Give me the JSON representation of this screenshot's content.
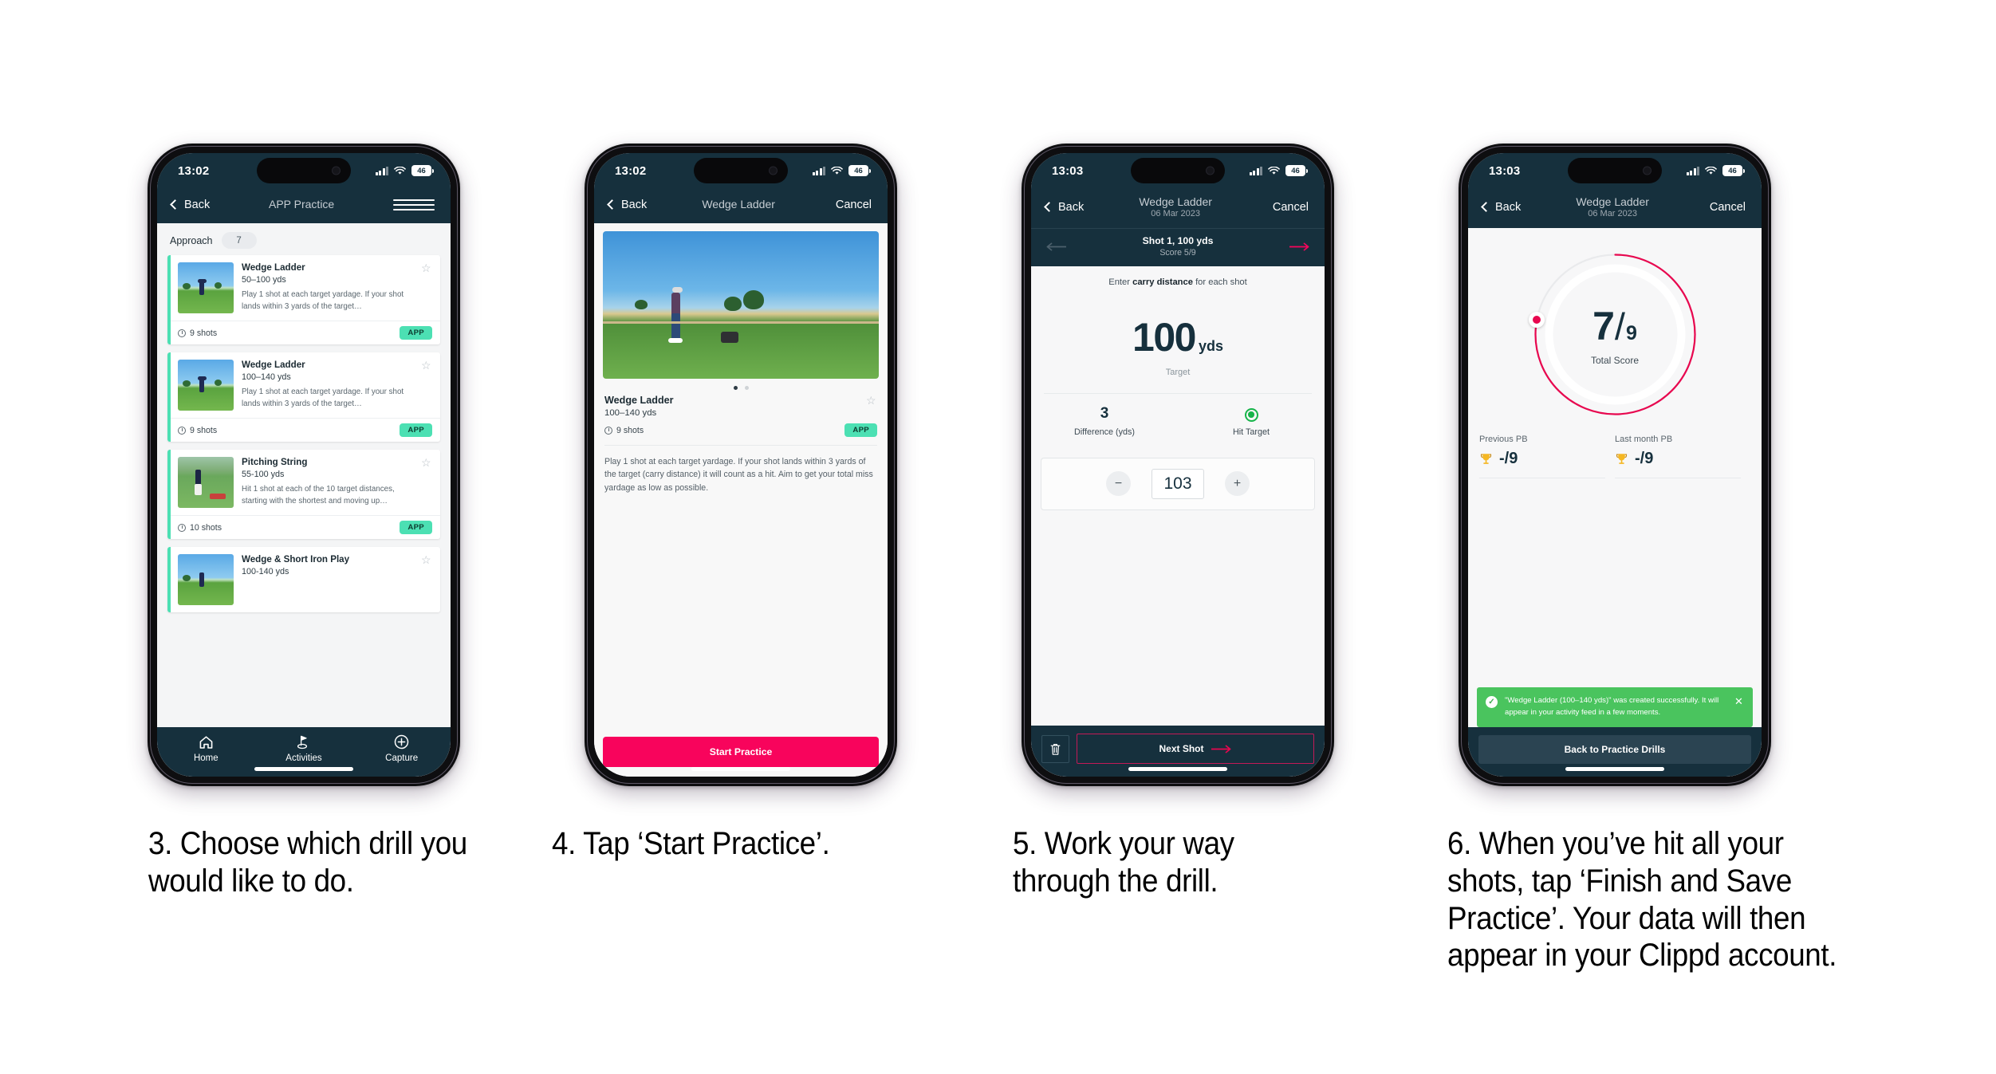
{
  "accent": {
    "pink": "#f8045c",
    "navy": "#16303d",
    "mint": "#4ce0b3",
    "green": "#4ac45e",
    "ring": "#d6nbsp"
  },
  "phones": [
    {
      "id": "phone-1",
      "status": {
        "time": "13:02",
        "battery": "46",
        "signal_icon": "signal-bars-icon",
        "wifi_icon": "wifi-icon"
      },
      "nav": {
        "back": "Back",
        "title": "APP Practice",
        "menu_icon": "hamburger-menu-icon"
      },
      "filter": {
        "label": "Approach",
        "count": "7"
      },
      "cards": [
        {
          "title": "Wedge Ladder",
          "range": "50–100 yds",
          "desc": "Play 1 shot at each target yardage. If your shot lands within 3 yards of the target…",
          "shots": "9 shots",
          "badge": "APP",
          "star_icon": "star-outline-icon",
          "thumb": "golfer-wedge-thumbnail"
        },
        {
          "title": "Wedge Ladder",
          "range": "100–140 yds",
          "desc": "Play 1 shot at each target yardage. If your shot lands within 3 yards of the target…",
          "shots": "9 shots",
          "badge": "APP",
          "star_icon": "star-outline-icon",
          "thumb": "golfer-wedge-thumbnail"
        },
        {
          "title": "Pitching String",
          "range": "55-100 yds",
          "desc": "Hit 1 shot at each of the 10 target distances, starting with the shortest and moving up…",
          "shots": "10 shots",
          "badge": "APP",
          "star_icon": "star-outline-icon",
          "thumb": "golfer-pitching-thumbnail"
        },
        {
          "title": "Wedge & Short Iron Play",
          "range": "100-140 yds",
          "desc": "",
          "shots": "",
          "badge": "",
          "star_icon": "star-outline-icon",
          "thumb": "golfer-wedge-thumbnail"
        }
      ],
      "tabs": [
        {
          "label": "Home",
          "icon": "home-icon"
        },
        {
          "label": "Activities",
          "icon": "golf-flag-icon"
        },
        {
          "label": "Capture",
          "icon": "plus-circle-icon"
        }
      ]
    },
    {
      "id": "phone-2",
      "status": {
        "time": "13:02",
        "battery": "46"
      },
      "nav": {
        "back": "Back",
        "title": "Wedge Ladder",
        "cancel": "Cancel"
      },
      "hero_image": "golfer-hitting-wedge-photo",
      "carousel": {
        "slides": "2",
        "active": "1"
      },
      "drill": {
        "title": "Wedge Ladder",
        "range": "100–140 yds",
        "shots": "9 shots",
        "badge": "APP",
        "star_icon": "star-outline-icon",
        "description": "Play 1 shot at each target yardage. If your shot lands within 3 yards of the target (carry distance) it will count as a hit. Aim to get your total miss yardage as low as possible."
      },
      "cta": "Start Practice"
    },
    {
      "id": "phone-3",
      "status": {
        "time": "13:03",
        "battery": "46"
      },
      "nav": {
        "back": "Back",
        "title": "Wedge Ladder",
        "subtitle": "06 Mar 2023",
        "cancel": "Cancel"
      },
      "subnav": {
        "shot_label": "Shot 1, 100 yds",
        "score_label": "Score 5/9",
        "prev_icon": "arrow-left-icon",
        "next_icon": "arrow-right-icon"
      },
      "hint_pre": "Enter ",
      "hint_bold": "carry distance",
      "hint_post": " for each shot",
      "target": {
        "value": "100",
        "unit": "yds",
        "caption": "Target"
      },
      "stats": [
        {
          "value": "3",
          "label": "Difference (yds)"
        },
        {
          "value": "",
          "label": "Hit Target",
          "icon": "target-dot-icon"
        }
      ],
      "stepper": {
        "minus": "−",
        "value": "103",
        "plus": "+"
      },
      "footer": {
        "delete_icon": "trash-icon",
        "next": "Next Shot",
        "next_icon": "arrow-right-icon"
      }
    },
    {
      "id": "phone-4",
      "status": {
        "time": "13:03",
        "battery": "46"
      },
      "nav": {
        "back": "Back",
        "title": "Wedge Ladder",
        "subtitle": "06 Mar 2023",
        "cancel": "Cancel"
      },
      "score": {
        "value": "7",
        "slash": "/",
        "total": "9",
        "label": "Total Score",
        "percent": 78
      },
      "pbs": [
        {
          "label": "Previous PB",
          "value": "-/9",
          "icon": "trophy-icon"
        },
        {
          "label": "Last month PB",
          "value": "-/9",
          "icon": "trophy-icon"
        }
      ],
      "toast": {
        "message": "\"Wedge Ladder (100–140 yds)\" was created successfully. It will appear in your activity feed in a few moments.",
        "check_icon": "check-circle-icon",
        "close_icon": "close-icon"
      },
      "cta": "Back to Practice Drills"
    }
  ],
  "captions": [
    "3. Choose which drill you would like to do.",
    "4. Tap ‘Start Practice’.",
    "5. Work your way through the drill.",
    "6. When you’ve hit all your shots, tap ‘Finish and Save Practice’. Your data will then appear in your Clippd account."
  ]
}
